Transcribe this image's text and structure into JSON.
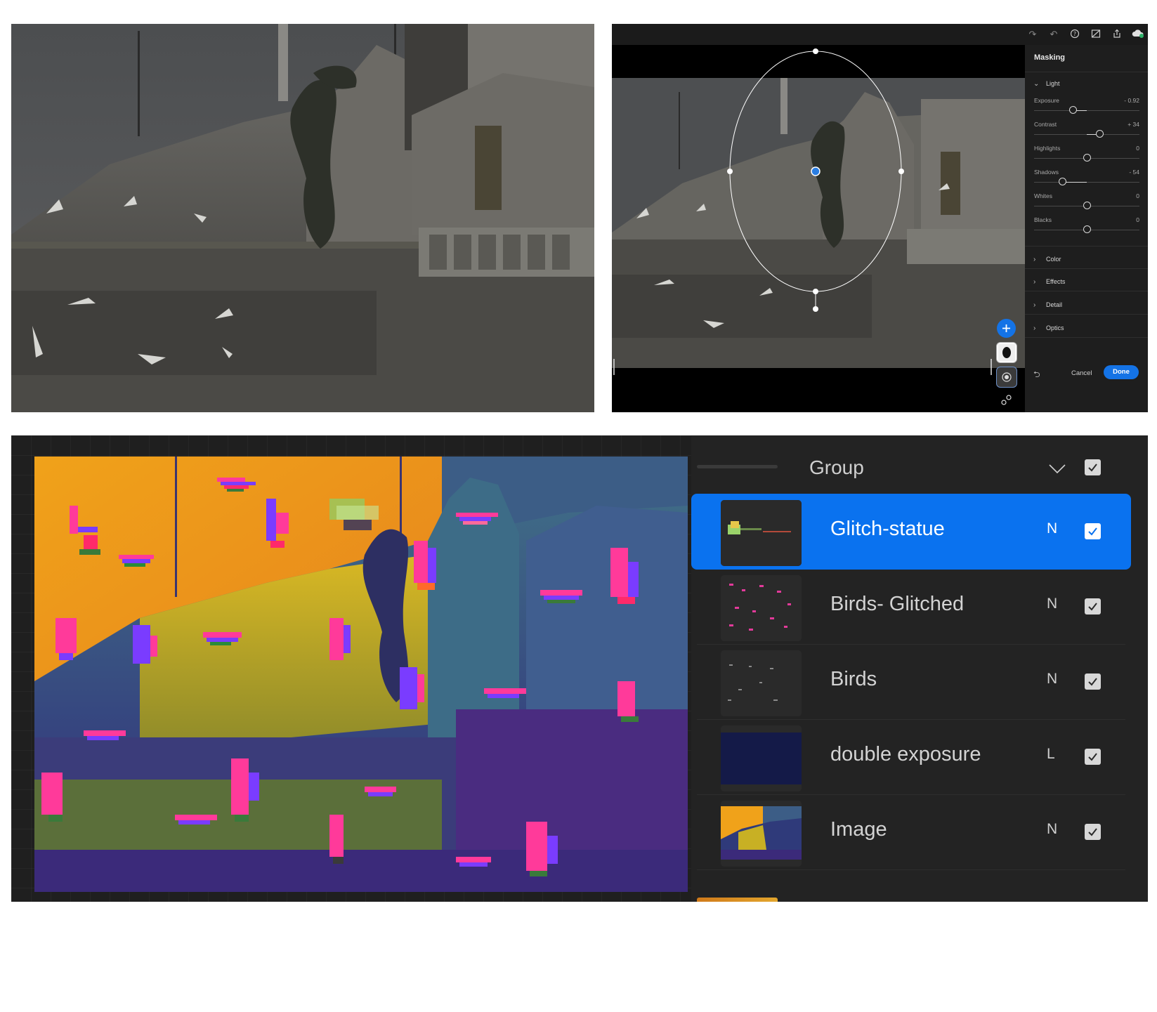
{
  "lightroom": {
    "panel_title": "Masking",
    "sections": {
      "light": "Light",
      "color": "Color",
      "effects": "Effects",
      "detail": "Detail",
      "optics": "Optics"
    },
    "sliders": [
      {
        "name": "Exposure",
        "value": "- 0.92",
        "position": 0.37
      },
      {
        "name": "Contrast",
        "value": "+ 34",
        "position": 0.62
      },
      {
        "name": "Highlights",
        "value": "0",
        "position": 0.5
      },
      {
        "name": "Shadows",
        "value": "- 54",
        "position": 0.27
      },
      {
        "name": "Whites",
        "value": "0",
        "position": 0.5
      },
      {
        "name": "Blacks",
        "value": "0",
        "position": 0.5
      }
    ],
    "cancel_label": "Cancel",
    "done_label": "Done",
    "accent_color": "#1473e6",
    "top_icons": [
      "redo-icon",
      "undo-icon",
      "help-icon",
      "compare-icon",
      "share-icon",
      "cloud-sync-icon"
    ],
    "mask_tool_icons": [
      "add-mask-icon",
      "mask-thumbnail-icon",
      "radial-mask-icon",
      "mask-options-icon"
    ]
  },
  "procreate": {
    "group_label": "Group",
    "layers": [
      {
        "name": "Glitch-statue",
        "mode": "N",
        "selected": true,
        "visible": true
      },
      {
        "name": "Birds- Glitched",
        "mode": "N",
        "selected": false,
        "visible": true
      },
      {
        "name": "Birds",
        "mode": "N",
        "selected": false,
        "visible": true
      },
      {
        "name": "double exposure",
        "mode": "L",
        "selected": false,
        "visible": true
      },
      {
        "name": "Image",
        "mode": "N",
        "selected": false,
        "visible": true
      }
    ],
    "selected_color": "#0a72ef"
  }
}
